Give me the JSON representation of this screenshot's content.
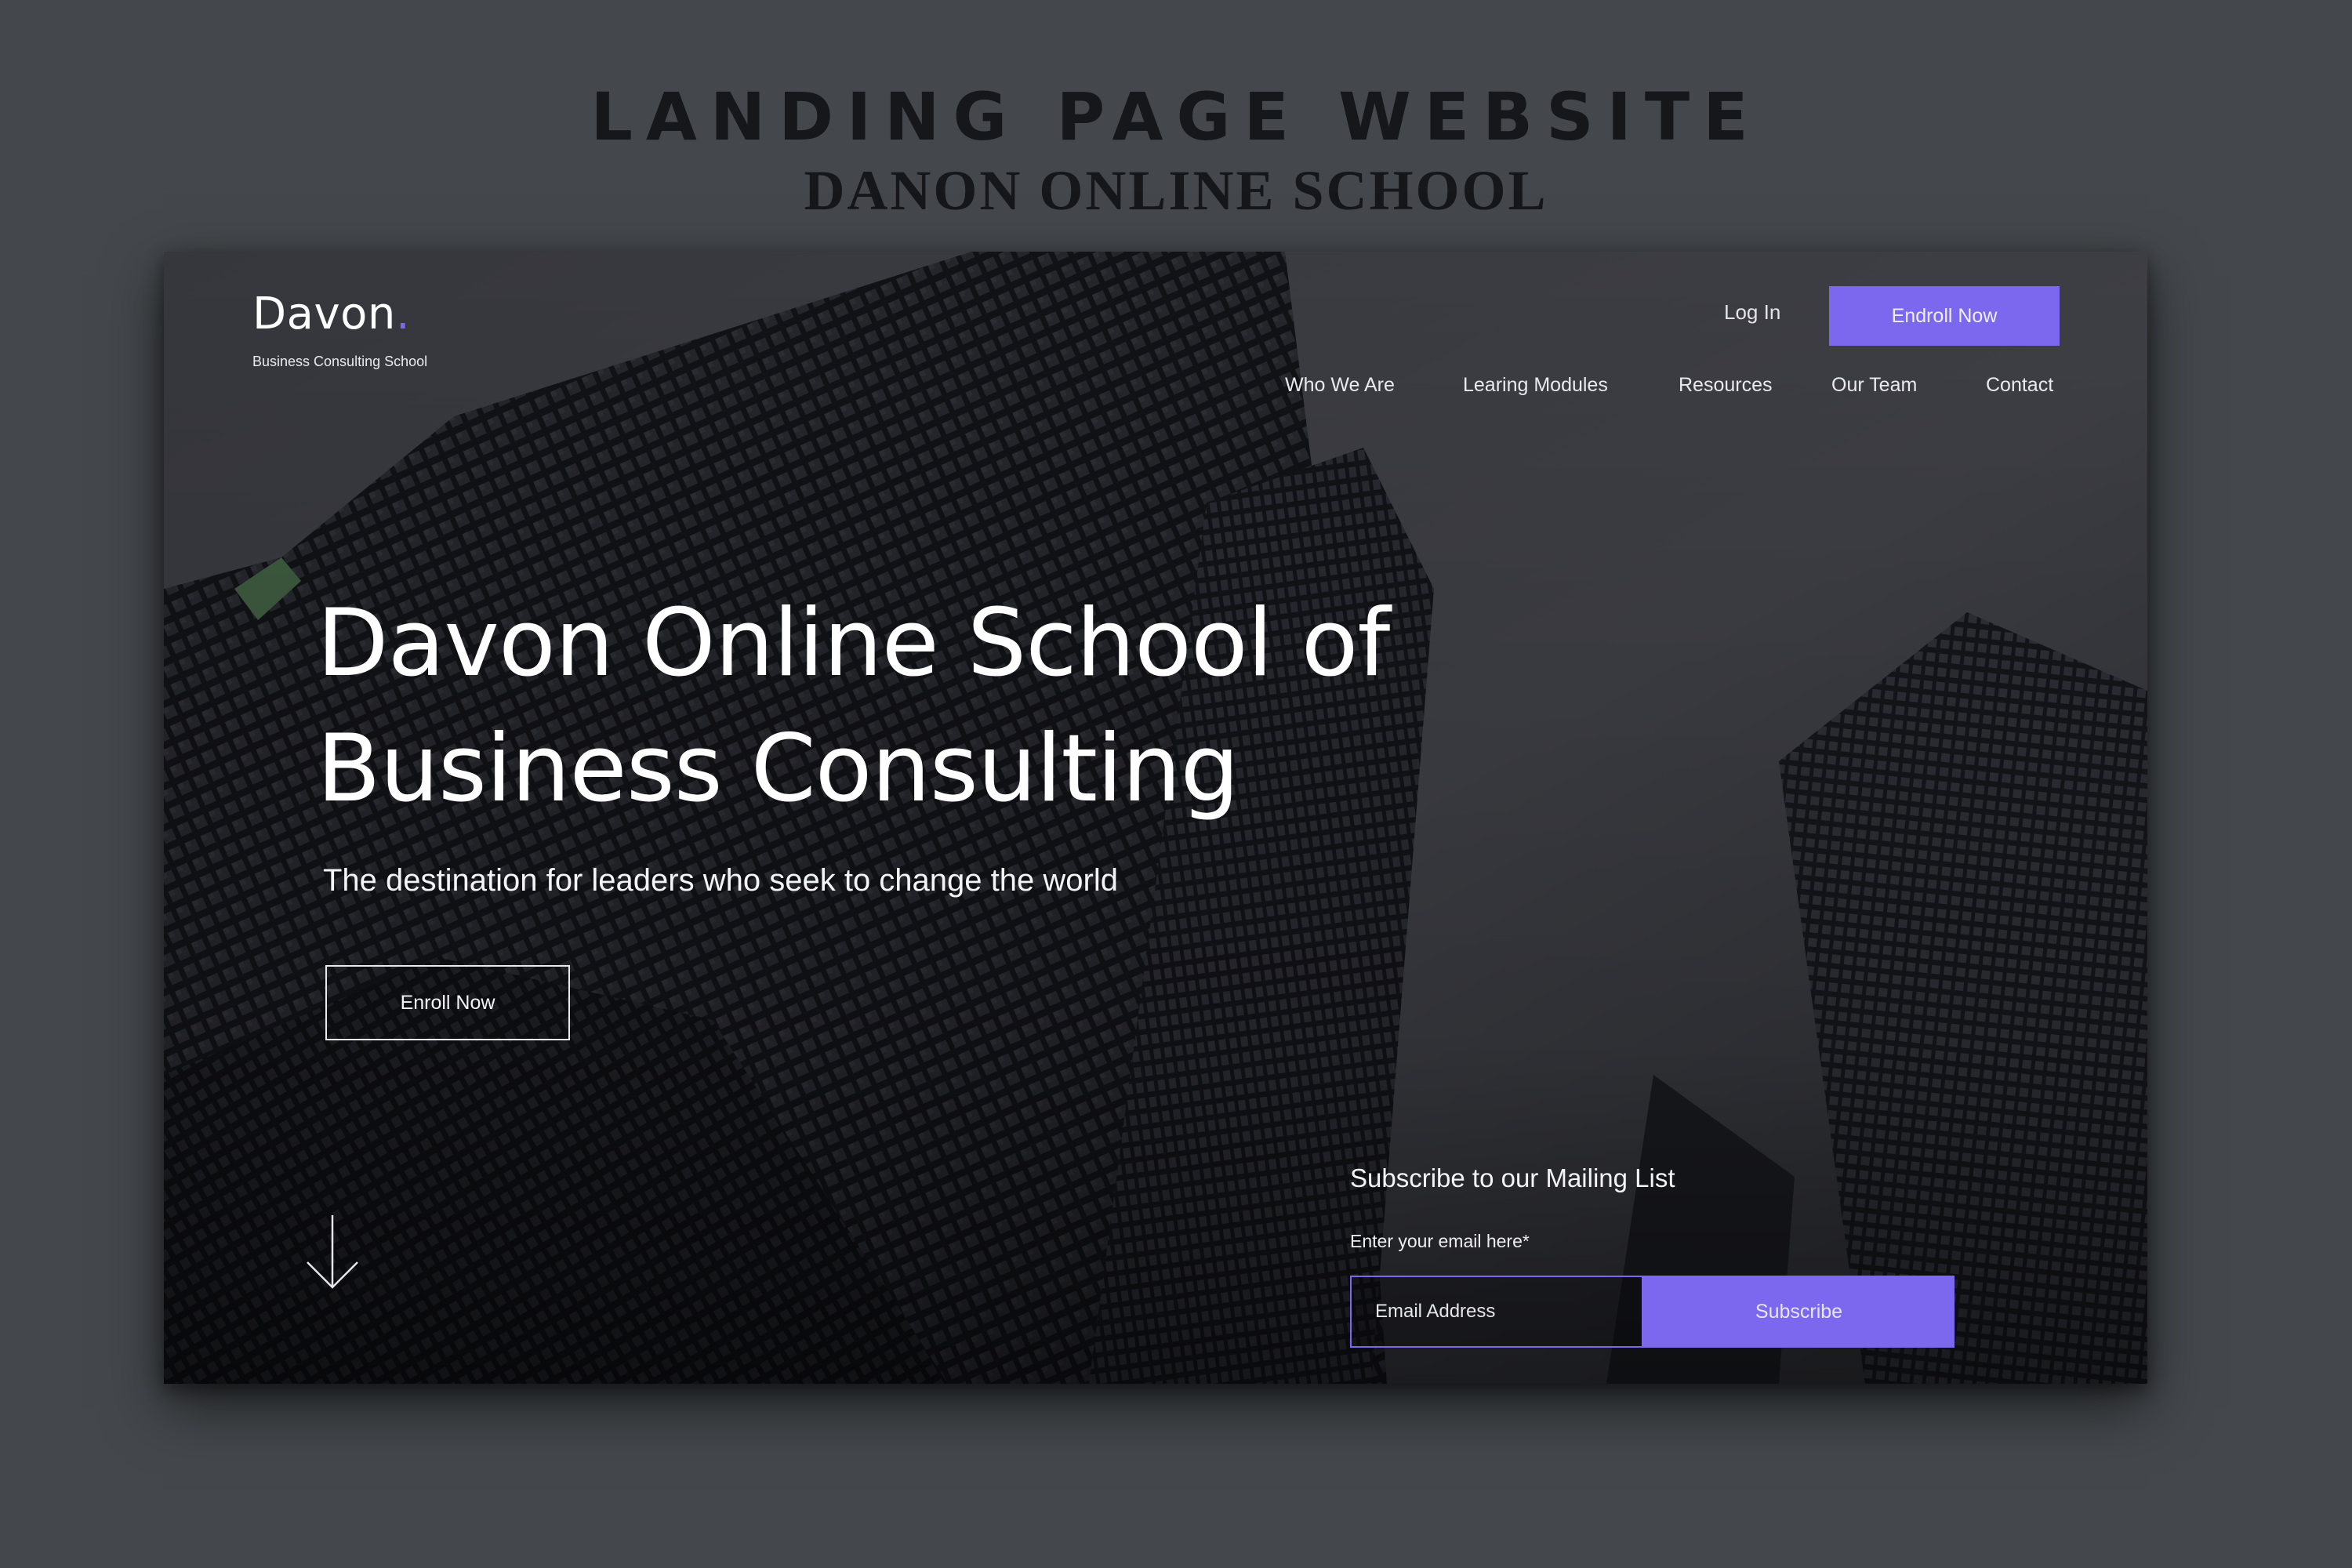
{
  "poster": {
    "title": "LANDING PAGE WEBSITE",
    "subtitle": "DANON ONLINE SCHOOL"
  },
  "header": {
    "brand_name": "Davon",
    "brand_dot": ".",
    "brand_tagline": "Business Consulting School",
    "login_label": "Log In",
    "enroll_label": "Endroll Now"
  },
  "nav": {
    "items": [
      {
        "label": "Who We Are"
      },
      {
        "label": "Learing Modules"
      },
      {
        "label": "Resources"
      },
      {
        "label": "Our Team"
      },
      {
        "label": "Contact"
      }
    ]
  },
  "hero": {
    "title_line1": "Davon Online School of",
    "title_line2": "Business Consulting",
    "subtitle": "The destination for leaders who seek to change the world",
    "cta_label": "Enroll Now",
    "scroll_icon": "arrow-down-icon"
  },
  "subscribe": {
    "heading": "Subscribe to our Mailing List",
    "label": "Enter your email here*",
    "placeholder": "Email Address",
    "button_label": "Subscribe"
  },
  "colors": {
    "accent": "#7b68ee",
    "page_background": "#44484c",
    "poster_text": "#15171a"
  }
}
